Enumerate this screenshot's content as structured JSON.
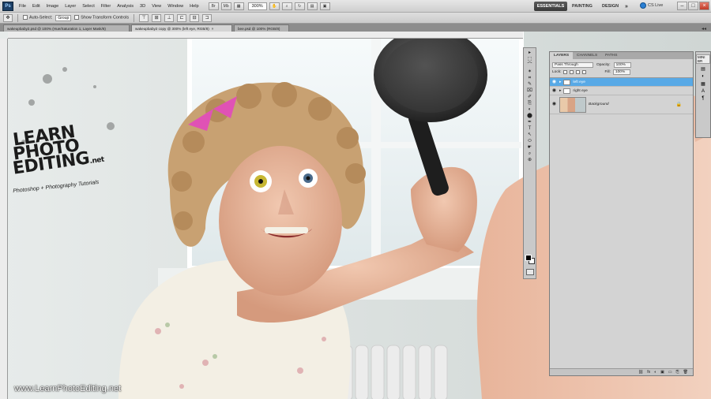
{
  "menubar": {
    "logo": "Ps",
    "menus": [
      "File",
      "Edit",
      "Image",
      "Layer",
      "Select",
      "Filter",
      "Analysis",
      "3D",
      "View",
      "Window",
      "Help"
    ],
    "zoom": "300%",
    "workspaces": {
      "essentials": "ESSENTIALS",
      "painting": "PAINTING",
      "design": "DESIGN",
      "more": "»"
    },
    "cslive": "CS Live",
    "win": {
      "min": "–",
      "max": "□",
      "close": "×"
    }
  },
  "options": {
    "tool_icon": "move-tool",
    "auto_select_label": "Auto-Select:",
    "auto_select_value": "Group",
    "transform_label": "Show Transform Controls"
  },
  "tabs": [
    {
      "label": "wakeupbaby2.psd @ 100% (Hue/Saturation 1, Layer Mask/8)",
      "active": false
    },
    {
      "label": "wakeupbaby2 copy @ 300% (left eye, RGB/8)",
      "active": true
    },
    {
      "label": "bee.psd @ 100% (RGB/8)",
      "active": false
    }
  ],
  "tools": [
    "▸",
    "⬚",
    "⌒",
    "✶",
    "⌗",
    "✎",
    "⌧",
    "✐",
    "⎘",
    "◐",
    "⬤",
    "✒",
    "T",
    "↖",
    "⬭",
    "☛",
    "⌕",
    "⊕"
  ],
  "layers_panel": {
    "tabs": [
      "LAYERS",
      "CHANNELS",
      "PATHS"
    ],
    "blend_mode": "Pass Through",
    "opacity_label": "Opacity:",
    "opacity": "100%",
    "lock_label": "Lock:",
    "fill_label": "Fill:",
    "fill": "100%",
    "layers": [
      {
        "name": "left eye",
        "selected": true,
        "type": "group"
      },
      {
        "name": "right eye",
        "selected": false,
        "type": "group"
      },
      {
        "name": "Background",
        "selected": false,
        "type": "background"
      }
    ],
    "footer_icons": [
      "fx",
      "◐",
      "▣",
      "▭",
      "⎘",
      "🗑"
    ]
  },
  "strip": {
    "top_tag": "MINI BR"
  },
  "watermark": {
    "logo_lines": [
      "LEARN",
      "PHOTO",
      "EDITING"
    ],
    "logo_suffix": ".net",
    "tagline": "Photoshop + Photography Tutorials",
    "url": "www.LearnPhotoEditing.net"
  }
}
